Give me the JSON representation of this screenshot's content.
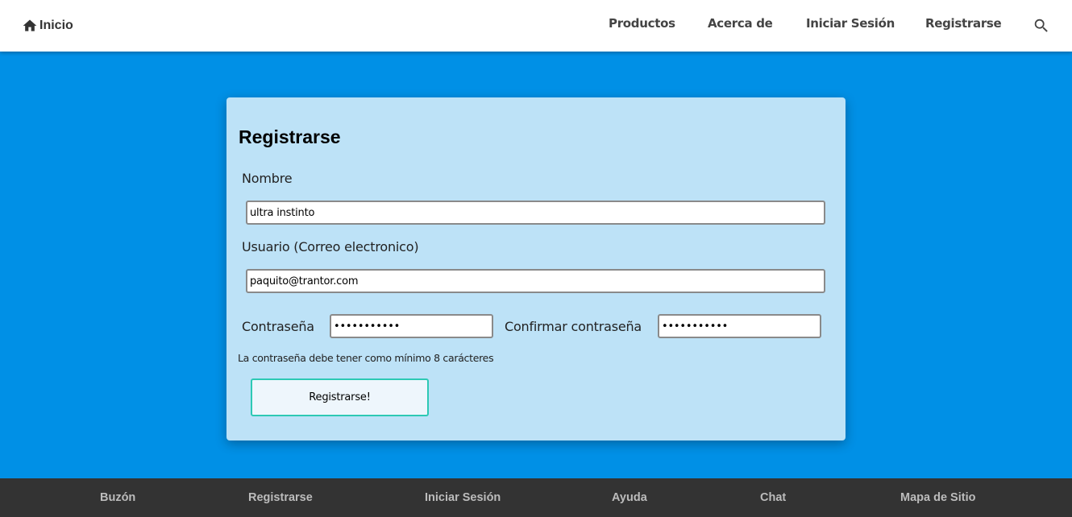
{
  "navbar": {
    "home_label": "Inicio",
    "home_icon": "home-icon",
    "items": [
      {
        "label": "Productos"
      },
      {
        "label": "Acerca de"
      },
      {
        "label": "Iniciar Sesión"
      },
      {
        "label": "Registrarse"
      }
    ],
    "search_icon": "search-icon"
  },
  "form": {
    "title": "Registrarse",
    "nombre": {
      "label": "Nombre",
      "value": "ultra instinto"
    },
    "usuario": {
      "label": "Usuario (Correo electronico)",
      "value": "paquito@trantor.com"
    },
    "password": {
      "label": "Contraseña",
      "value": "•••••••••••"
    },
    "confirm_password": {
      "label": "Confirmar contraseña",
      "value": "•••••••••••"
    },
    "hint": "La contraseña debe tener como mínimo 8 carácteres",
    "submit_label": "Registrarse!"
  },
  "footer": {
    "items": [
      {
        "label": "Buzón"
      },
      {
        "label": "Registrarse"
      },
      {
        "label": "Iniciar Sesión"
      },
      {
        "label": "Ayuda"
      },
      {
        "label": "Chat"
      },
      {
        "label": "Mapa de Sitio"
      }
    ]
  },
  "colors": {
    "page_background": "#0090e6",
    "card_background": "#bde2f7",
    "footer_background": "#333333",
    "button_border": "#2dc9b4"
  }
}
